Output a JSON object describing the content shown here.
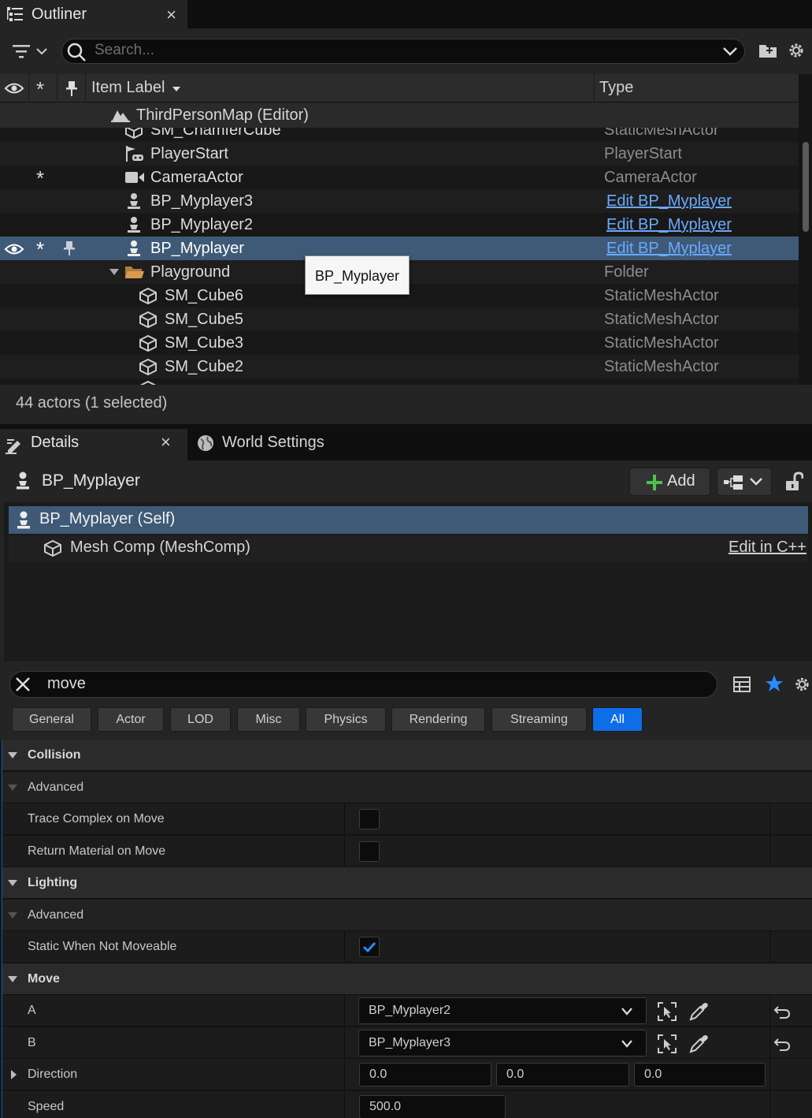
{
  "outliner": {
    "tab_title": "Outliner",
    "close_glyph": "×",
    "search_placeholder": "Search...",
    "columns": {
      "label": "Item Label",
      "type": "Type"
    },
    "world_row": "ThirdPersonMap (Editor)",
    "partial_top": {
      "label": "SM_ChamferCube",
      "type": "StaticMeshActor"
    },
    "rows": [
      {
        "label": "PlayerStart",
        "type": "PlayerStart",
        "icon": "player-start-icon"
      },
      {
        "label": "CameraActor",
        "type": "CameraActor",
        "icon": "camera-icon",
        "star": "*"
      },
      {
        "label": "BP_Myplayer3",
        "type": "Edit BP_Myplayer",
        "icon": "pawn-icon"
      },
      {
        "label": "BP_Myplayer2",
        "type": "Edit BP_Myplayer",
        "icon": "pawn-icon"
      },
      {
        "label": "BP_Myplayer",
        "type": "Edit BP_Myplayer",
        "icon": "pawn-icon",
        "star": "*"
      },
      {
        "label": "Playground",
        "type": "Folder",
        "icon": "folder-icon"
      },
      {
        "label": "SM_Cube6",
        "type": "StaticMeshActor",
        "icon": "mesh-icon"
      },
      {
        "label": "SM_Cube5",
        "type": "StaticMeshActor",
        "icon": "mesh-icon"
      },
      {
        "label": "SM_Cube3",
        "type": "StaticMeshActor",
        "icon": "mesh-icon"
      },
      {
        "label": "SM_Cube2",
        "type": "StaticMeshActor",
        "icon": "mesh-icon"
      }
    ],
    "tooltip": "BP_Myplayer",
    "status": "44 actors (1 selected)"
  },
  "details": {
    "tab_title": "Details",
    "close_glyph": "×",
    "world_settings_tab": "World Settings",
    "actor_name": "BP_Myplayer",
    "add_label": "Add",
    "components": {
      "self": "BP_Myplayer (Self)",
      "mesh": "Mesh Comp (MeshComp)",
      "edit_cpp": "Edit in C++"
    },
    "search_value": "move",
    "categories": [
      "General",
      "Actor",
      "LOD",
      "Misc",
      "Physics",
      "Rendering",
      "Streaming",
      "All"
    ],
    "active_category": "All",
    "properties": {
      "collision": "Collision",
      "collision_advanced": "Advanced",
      "trace_complex": "Trace Complex on Move",
      "return_material": "Return Material on Move",
      "lighting": "Lighting",
      "lighting_advanced": "Advanced",
      "static_not_moveable": "Static When Not Moveable",
      "move": "Move",
      "a_label": "A",
      "a_value": "BP_Myplayer2",
      "b_label": "B",
      "b_value": "BP_Myplayer3",
      "direction_label": "Direction",
      "direction": [
        "0.0",
        "0.0",
        "0.0"
      ],
      "speed_label": "Speed",
      "speed_value": "500.0"
    },
    "checkbox_states": {
      "trace_complex": false,
      "return_material": false,
      "static_not_moveable": true
    }
  },
  "colors": {
    "selection": "#3f5a77",
    "link": "#6aa9ff",
    "accent": "#0e6ee8"
  }
}
